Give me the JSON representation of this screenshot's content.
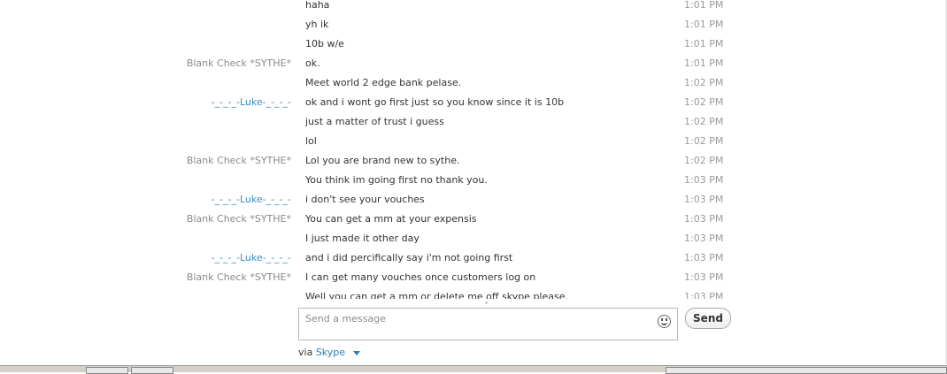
{
  "messages": [
    {
      "sender": "",
      "text": "haha",
      "time": "1:01 PM",
      "me": false
    },
    {
      "sender": "",
      "text": "yh ik",
      "time": "1:01 PM",
      "me": false
    },
    {
      "sender": "",
      "text": "10b w/e",
      "time": "1:01 PM",
      "me": false
    },
    {
      "sender": "Blank Check *SYTHE*",
      "text": "ok.",
      "time": "1:01 PM",
      "me": false
    },
    {
      "sender": "",
      "text": "Meet world 2 edge bank pelase.",
      "time": "1:02 PM",
      "me": false
    },
    {
      "sender": "-_-_-_-Luke-_-_-_-",
      "text": "ok and i wont go first just so you know since it is 10b",
      "time": "1:02 PM",
      "me": true
    },
    {
      "sender": "",
      "text": "just a matter of trust i guess",
      "time": "1:02 PM",
      "me": true
    },
    {
      "sender": "",
      "text": "lol",
      "time": "1:02 PM",
      "me": true
    },
    {
      "sender": "Blank Check *SYTHE*",
      "text": "Lol you are brand new to sythe.",
      "time": "1:02 PM",
      "me": false
    },
    {
      "sender": "",
      "text": "You think im going first no thank you.",
      "time": "1:03 PM",
      "me": false
    },
    {
      "sender": "-_-_-_-Luke-_-_-_-",
      "text": "i don't see your vouches",
      "time": "1:03 PM",
      "me": true
    },
    {
      "sender": "Blank Check *SYTHE*",
      "text": "You can get a mm at your expensis",
      "time": "1:03 PM",
      "me": false
    },
    {
      "sender": "",
      "text": "I just made it other day",
      "time": "1:03 PM",
      "me": false
    },
    {
      "sender": "-_-_-_-Luke-_-_-_-",
      "text": "and i did percifically say i'm not going first",
      "time": "1:03 PM",
      "me": true
    },
    {
      "sender": "Blank Check *SYTHE*",
      "text": "I can get many vouches once customers log on",
      "time": "1:03 PM",
      "me": false
    },
    {
      "sender": "",
      "text": "Well you can get a mm or delete me off skype please.",
      "time": "1:03 PM",
      "me": false
    }
  ],
  "composer": {
    "placeholder": "Send a message",
    "emoticon_icon": "smiley-icon",
    "send_label": "Send"
  },
  "via": {
    "label": "via",
    "service": "Skype",
    "caret_icon": "chevron-down-icon"
  },
  "colors": {
    "me_sender": "#3a8ebf",
    "other_sender": "#8a8a8a",
    "link": "#2a7db6"
  }
}
